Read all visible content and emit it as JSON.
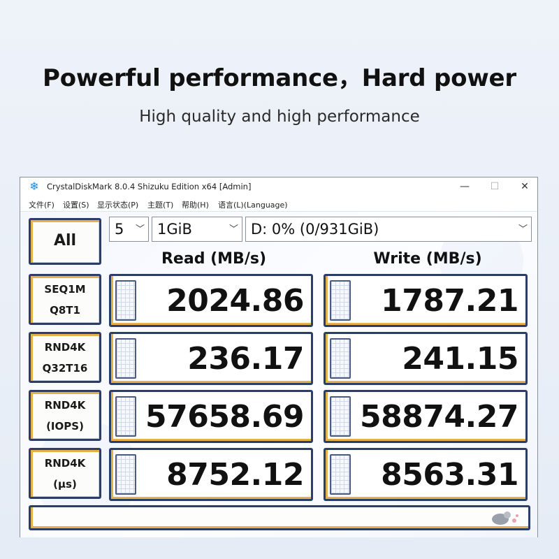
{
  "headline": "Powerful performance，Hard power",
  "subline": "High quality and high performance",
  "window": {
    "title": "CrystalDiskMark 8.0.4 Shizuku Edition x64 [Admin]",
    "controls": {
      "minimize": "—",
      "maximize": "☐",
      "close": "✕"
    },
    "menu": [
      "文件(F)",
      "设置(S)",
      "显示状态(P)",
      "主题(T)",
      "帮助(H)",
      "语言(L)(Language)"
    ]
  },
  "controls": {
    "all_button": "All",
    "count_select": "5",
    "size_select": "1GiB",
    "drive_select": "D: 0% (0/931GiB)"
  },
  "columns": {
    "read": "Read (MB/s)",
    "write": "Write (MB/s)"
  },
  "tests": [
    {
      "line1": "SEQ1M",
      "line2": "Q8T1",
      "read": "2024.86",
      "write": "1787.21"
    },
    {
      "line1": "RND4K",
      "line2": "Q32T16",
      "read": "236.17",
      "write": "241.15"
    },
    {
      "line1": "RND4K",
      "line2": "(IOPS)",
      "read": "57658.69",
      "write": "58874.27"
    },
    {
      "line1": "RND4K",
      "line2": "(μs)",
      "read": "8752.12",
      "write": "8563.31"
    }
  ],
  "status_text": "",
  "colors": {
    "frame": "#2c3e68",
    "accent": "#e4b14c",
    "app_icon": "#1d8de0"
  },
  "icons": {
    "app": "crystaldiskmark-icon",
    "status": "mascot-icon"
  }
}
